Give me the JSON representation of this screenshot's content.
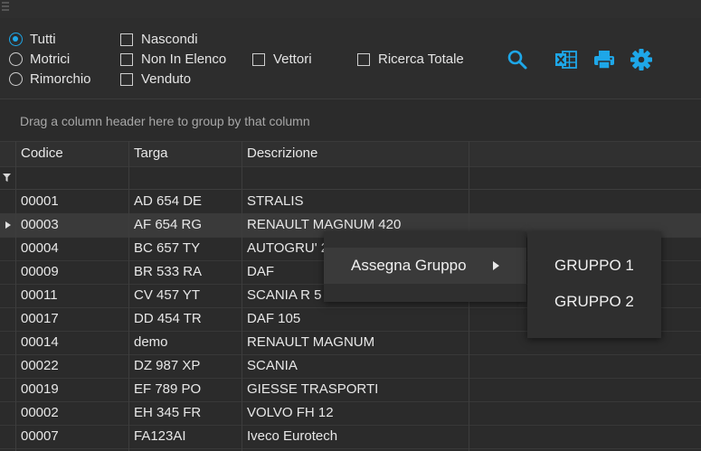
{
  "filters": {
    "radios": [
      {
        "label": "Tutti",
        "selected": true
      },
      {
        "label": "Motrici",
        "selected": false
      },
      {
        "label": "Rimorchio",
        "selected": false
      }
    ],
    "checks": [
      {
        "label": "Nascondi",
        "checked": false
      },
      {
        "label": "Non In Elenco",
        "checked": false
      },
      {
        "label": "Venduto",
        "checked": false
      },
      {
        "label": "Vettori",
        "checked": false
      },
      {
        "label": "Ricerca Totale",
        "checked": false
      }
    ]
  },
  "toolbar_icons": [
    "search-icon",
    "excel-export-icon",
    "print-icon",
    "settings-gear-icon"
  ],
  "accent_color": "#1ea7e8",
  "group_panel_text": "Drag a column header here to group by that column",
  "grid": {
    "columns": [
      "Codice",
      "Targa",
      "Descrizione"
    ],
    "rows": [
      [
        "00001",
        "AD 654 DE",
        "STRALIS"
      ],
      [
        "00003",
        "AF 654 RG",
        "RENAULT MAGNUM 420"
      ],
      [
        "00004",
        "BC 657 TY",
        "AUTOGRU' 2"
      ],
      [
        "00009",
        "BR 533 RA",
        "DAF"
      ],
      [
        "00011",
        "CV 457 YT",
        "SCANIA R 5"
      ],
      [
        "00017",
        "DD 454 TR",
        "DAF 105"
      ],
      [
        "00014",
        "demo",
        "RENAULT MAGNUM"
      ],
      [
        "00022",
        "DZ 987 XP",
        "SCANIA"
      ],
      [
        "00019",
        "EF 789 PO",
        "GIESSE TRASPORTI"
      ],
      [
        "00002",
        "EH 345 FR",
        "VOLVO FH 12"
      ],
      [
        "00007",
        "FA123AI",
        "Iveco Eurotech"
      ]
    ],
    "selected_row_index": 1
  },
  "context_menu": {
    "item": "Assegna Gruppo",
    "submenu": [
      "GRUPPO 1",
      "GRUPPO 2"
    ]
  }
}
